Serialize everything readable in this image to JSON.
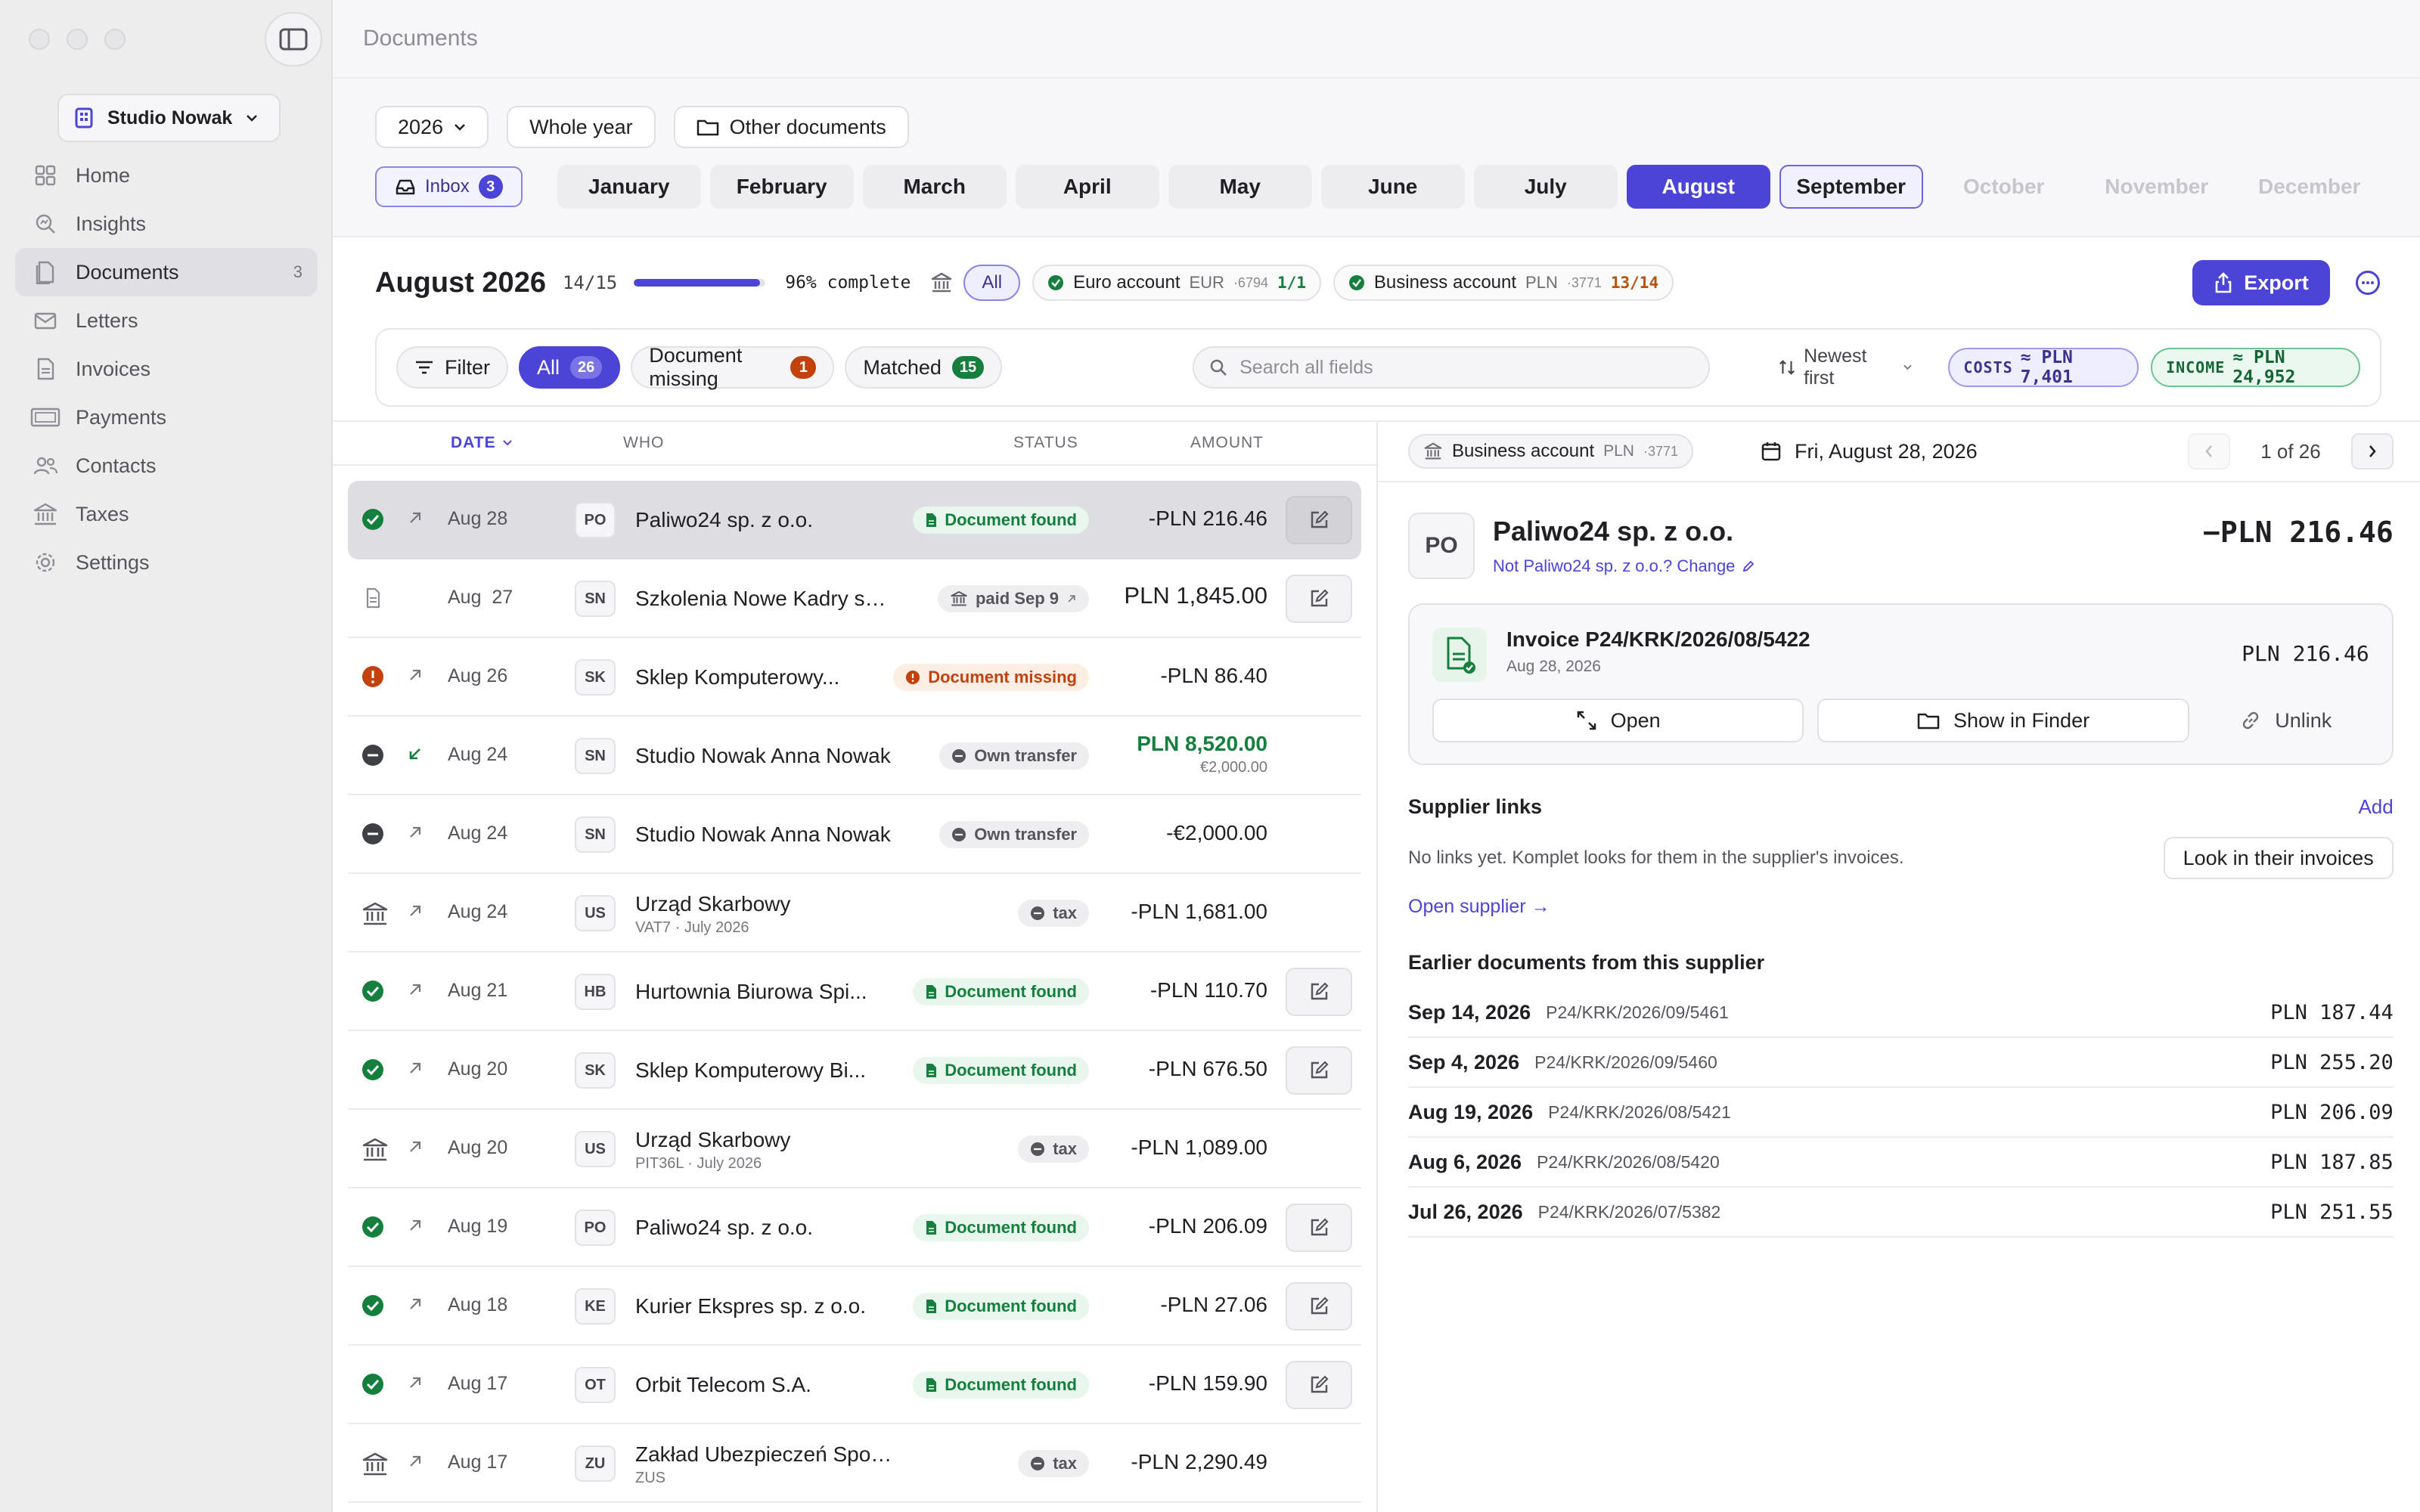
{
  "sidebar": {
    "workspace": "Studio Nowak",
    "items": [
      {
        "label": "Home",
        "icon": "home-icon",
        "count": ""
      },
      {
        "label": "Insights",
        "icon": "insights-icon",
        "count": ""
      },
      {
        "label": "Documents",
        "icon": "documents-icon",
        "count": "3"
      },
      {
        "label": "Letters",
        "icon": "letters-icon",
        "count": ""
      },
      {
        "label": "Invoices",
        "icon": "invoices-icon",
        "count": ""
      },
      {
        "label": "Payments",
        "icon": "payments-icon",
        "count": ""
      },
      {
        "label": "Contacts",
        "icon": "contacts-icon",
        "count": ""
      },
      {
        "label": "Taxes",
        "icon": "taxes-icon",
        "count": ""
      },
      {
        "label": "Settings",
        "icon": "settings-icon",
        "count": ""
      }
    ]
  },
  "header": {
    "title": "Documents"
  },
  "periods": {
    "year": "2026",
    "range": "Whole year",
    "other": "Other documents",
    "inbox_label": "Inbox",
    "inbox_count": "3",
    "months": [
      "January",
      "February",
      "March",
      "April",
      "May",
      "June",
      "July",
      "August",
      "September",
      "October",
      "November",
      "December"
    ],
    "selected": "August"
  },
  "summary": {
    "title": "August 2026",
    "ratio": "14/15",
    "progress": 0.96,
    "pct_label": "96% complete",
    "all_label": "All",
    "accounts": [
      {
        "name": "Euro account",
        "currency": "EUR",
        "mask": "·6794",
        "matched": "1/1",
        "state": "ok"
      },
      {
        "name": "Business account",
        "currency": "PLN",
        "mask": "·3771",
        "matched": "13/14",
        "state": "warn"
      }
    ],
    "export_label": "Export"
  },
  "filters": {
    "filter_label": "Filter",
    "chips": [
      {
        "label": "All",
        "count": "26"
      },
      {
        "label": "Document missing",
        "count": "1"
      },
      {
        "label": "Matched",
        "count": "15"
      }
    ],
    "search_placeholder": "Search all fields",
    "sort_label": "Newest first",
    "costs_label": "COSTS",
    "costs_value": "≈ PLN 7,401",
    "income_label": "INCOME",
    "income_value": "≈ PLN 24,952"
  },
  "list": {
    "headers": {
      "date": "DATE",
      "who": "WHO",
      "status": "STATUS",
      "amount": "AMOUNT"
    },
    "rows": [
      {
        "state": "ok",
        "dir": "out",
        "date": "Aug 28",
        "av": "PO",
        "name": "Paliwo24 sp. z o.o.",
        "sub": "",
        "status": "Document found",
        "stype": "found",
        "amount": "-PLN 216.46",
        "orig": "",
        "edit": true
      },
      {
        "state": "doc",
        "dir": "",
        "date": "Aug  27",
        "av": "SN",
        "name": "Szkolenia Nowe Kadry sp...",
        "sub": "",
        "status": "paid Sep 9",
        "stype": "paid",
        "amount": "PLN 1,845.00",
        "orig": "",
        "edit": true,
        "big": true
      },
      {
        "state": "missing",
        "dir": "out",
        "date": "Aug 26",
        "av": "SK",
        "name": "Sklep Komputerowy...",
        "sub": "",
        "status": "Document missing",
        "stype": "missing",
        "amount": "-PLN 86.40",
        "orig": "",
        "edit": false
      },
      {
        "state": "transfer",
        "dir": "in",
        "date": "Aug 24",
        "av": "SN",
        "name": "Studio Nowak Anna Nowak",
        "sub": "",
        "status": "Own transfer",
        "stype": "transfer",
        "amount": "PLN 8,520.00",
        "orig": "€2,000.00",
        "edit": false,
        "income": true
      },
      {
        "state": "transfer",
        "dir": "out",
        "date": "Aug 24",
        "av": "SN",
        "name": "Studio Nowak Anna Nowak",
        "sub": "",
        "status": "Own transfer",
        "stype": "transfer",
        "amount": "-€2,000.00",
        "orig": "",
        "edit": false
      },
      {
        "state": "tax",
        "dir": "out",
        "date": "Aug 24",
        "av": "US",
        "name": "Urząd Skarbowy",
        "sub": "VAT7 · July 2026",
        "status": "tax",
        "stype": "transfer",
        "amount": "-PLN 1,681.00",
        "orig": "",
        "edit": false
      },
      {
        "state": "ok",
        "dir": "out",
        "date": "Aug 21",
        "av": "HB",
        "name": "Hurtownia Biurowa Spi...",
        "sub": "",
        "status": "Document found",
        "stype": "found",
        "amount": "-PLN 110.70",
        "orig": "",
        "edit": true
      },
      {
        "state": "ok",
        "dir": "out",
        "date": "Aug 20",
        "av": "SK",
        "name": "Sklep Komputerowy Bi...",
        "sub": "",
        "status": "Document found",
        "stype": "found",
        "amount": "-PLN 676.50",
        "orig": "",
        "edit": true
      },
      {
        "state": "tax",
        "dir": "out",
        "date": "Aug 20",
        "av": "US",
        "name": "Urząd Skarbowy",
        "sub": "PIT36L · July 2026",
        "status": "tax",
        "stype": "transfer",
        "amount": "-PLN 1,089.00",
        "orig": "",
        "edit": false
      },
      {
        "state": "ok",
        "dir": "out",
        "date": "Aug 19",
        "av": "PO",
        "name": "Paliwo24 sp. z o.o.",
        "sub": "",
        "status": "Document found",
        "stype": "found",
        "amount": "-PLN 206.09",
        "orig": "",
        "edit": true
      },
      {
        "state": "ok",
        "dir": "out",
        "date": "Aug 18",
        "av": "KE",
        "name": "Kurier Ekspres sp. z o.o.",
        "sub": "",
        "status": "Document found",
        "stype": "found",
        "amount": "-PLN 27.06",
        "orig": "",
        "edit": true
      },
      {
        "state": "ok",
        "dir": "out",
        "date": "Aug 17",
        "av": "OT",
        "name": "Orbit Telecom S.A.",
        "sub": "",
        "status": "Document found",
        "stype": "found",
        "amount": "-PLN 159.90",
        "orig": "",
        "edit": true
      },
      {
        "state": "tax",
        "dir": "out",
        "date": "Aug 17",
        "av": "ZU",
        "name": "Zakład Ubezpieczeń Społecznych",
        "sub": "ZUS",
        "status": "tax",
        "stype": "transfer",
        "amount": "-PLN 2,290.49",
        "orig": "",
        "edit": false
      }
    ]
  },
  "detail": {
    "account": "Business account",
    "account_currency": "PLN",
    "account_mask": "·3771",
    "date": "Fri, August 28, 2026",
    "pager": "1 of 26",
    "supplier_av": "PO",
    "supplier": "Paliwo24 sp. z o.o.",
    "change": "Not Paliwo24 sp. z o.o.? Change",
    "amount": "−PLN 216.46",
    "invoice": {
      "title": "Invoice P24/KRK/2026/08/5422",
      "date": "Aug 28, 2026",
      "amount": "PLN 216.46",
      "open": "Open",
      "finder": "Show in Finder",
      "unlink": "Unlink"
    },
    "links_title": "Supplier links",
    "links_add": "Add",
    "links_empty": "No links yet. Komplet looks for them in the supplier's invoices.",
    "look_btn": "Look in their invoices",
    "open_supplier": "Open supplier →",
    "earlier_title": "Earlier documents from this supplier",
    "earlier": [
      {
        "date": "Sep 14, 2026",
        "ref": "P24/KRK/2026/09/5461",
        "amount": "PLN 187.44"
      },
      {
        "date": "Sep 4, 2026",
        "ref": "P24/KRK/2026/09/5460",
        "amount": "PLN 255.20"
      },
      {
        "date": "Aug 19, 2026",
        "ref": "P24/KRK/2026/08/5421",
        "amount": "PLN 206.09"
      },
      {
        "date": "Aug 6, 2026",
        "ref": "P24/KRK/2026/08/5420",
        "amount": "PLN 187.85"
      },
      {
        "date": "Jul 26, 2026",
        "ref": "P24/KRK/2026/07/5382",
        "amount": "PLN 251.55"
      }
    ]
  },
  "colors": {
    "accent": "#4b44d6",
    "success": "#15803d",
    "warning": "#c2410c"
  }
}
